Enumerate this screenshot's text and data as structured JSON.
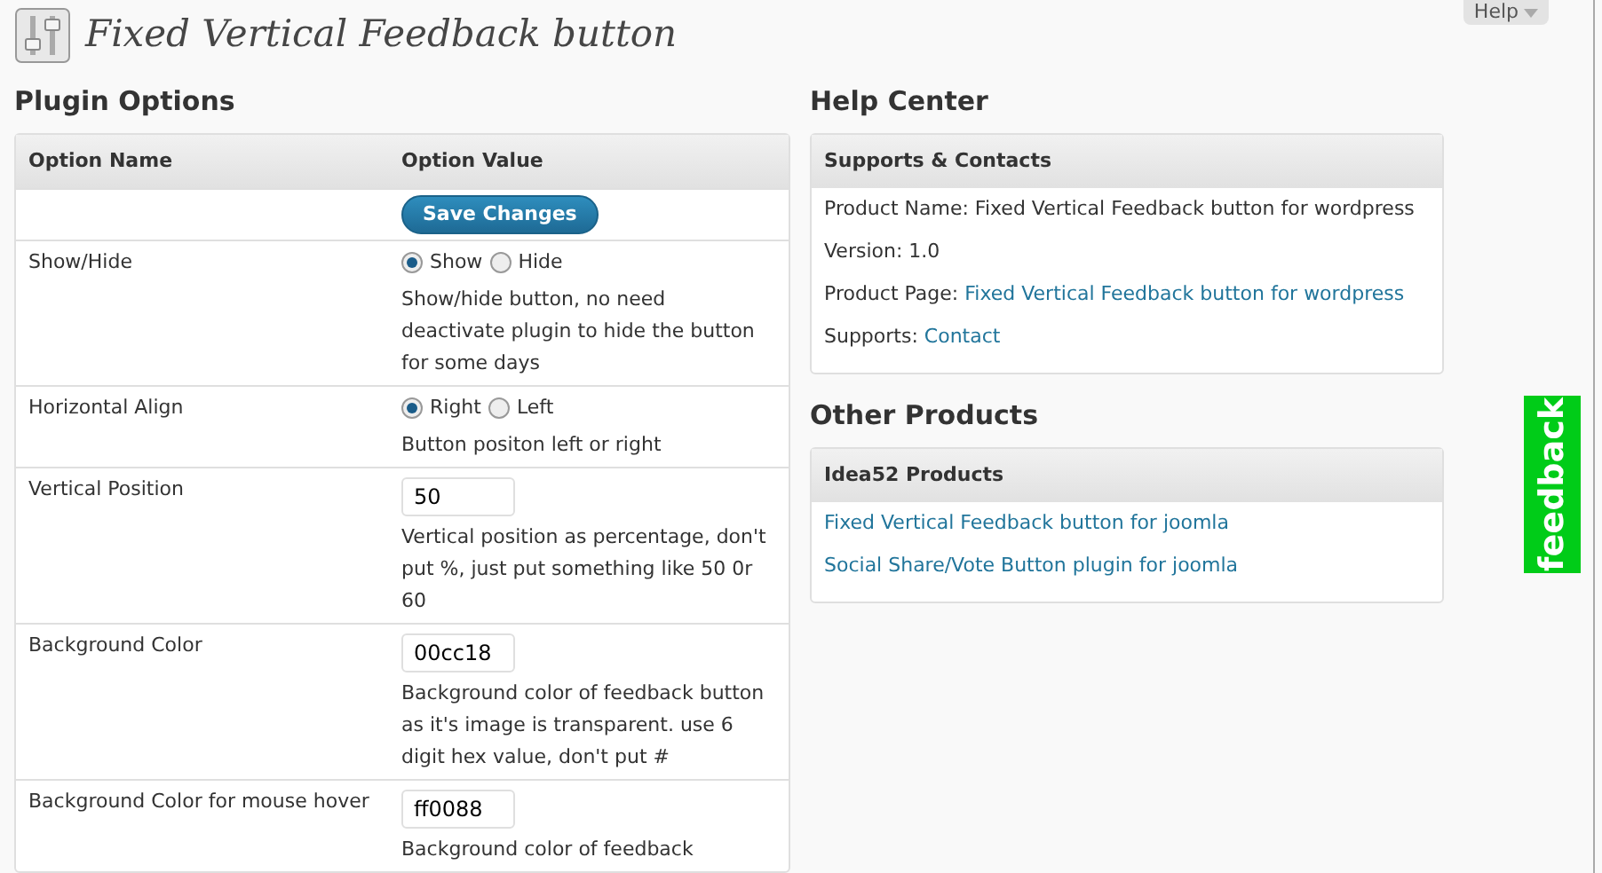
{
  "help_tab": {
    "label": "Help"
  },
  "page_title": "Fixed Vertical Feedback button",
  "plugin_options": {
    "heading": "Plugin Options",
    "columns": [
      "Option Name",
      "Option Value"
    ],
    "rows": [
      {
        "kind": "button",
        "label": "Save Changes"
      },
      {
        "kind": "radio",
        "name": "Show/Hide",
        "choices": [
          {
            "label": "Show",
            "selected": true
          },
          {
            "label": "Hide",
            "selected": false
          }
        ],
        "description": "Show/hide button, no need deactivate plugin to hide the button for some days"
      },
      {
        "kind": "radio",
        "name": "Horizontal Align",
        "choices": [
          {
            "label": "Right",
            "selected": true
          },
          {
            "label": "Left",
            "selected": false
          }
        ],
        "description": "Button positon left or right"
      },
      {
        "kind": "text",
        "name": "Vertical Position",
        "value": "50",
        "description": "Vertical position as percentage, don't put %, just put something like 50 0r 60"
      },
      {
        "kind": "text",
        "name": "Background Color",
        "value": "00cc18",
        "description": "Background color of feedback button as it's image is transparent. use 6 digit hex value, don't put #"
      },
      {
        "kind": "text",
        "name": "Background Color for mouse hover",
        "value": "ff0088",
        "description": "Background color of feedback"
      }
    ]
  },
  "help_center": {
    "heading": "Help Center",
    "title": "Supports & Contacts",
    "lines": [
      {
        "text": "Product Name: Fixed Vertical Feedback button for wordpress"
      },
      {
        "text": "Version: 1.0"
      },
      {
        "text": "Product Page:",
        "link": "Fixed Vertical Feedback button for wordpress"
      },
      {
        "text": "Supports:",
        "link": "Contact"
      }
    ]
  },
  "other_products": {
    "heading": "Other Products",
    "title": "Idea52 Products",
    "links": [
      "Fixed Vertical Feedback button for joomla",
      "Social Share/Vote Button plugin for joomla"
    ]
  },
  "feedback_tab": {
    "label": "feedback",
    "color": "#00cc18"
  }
}
